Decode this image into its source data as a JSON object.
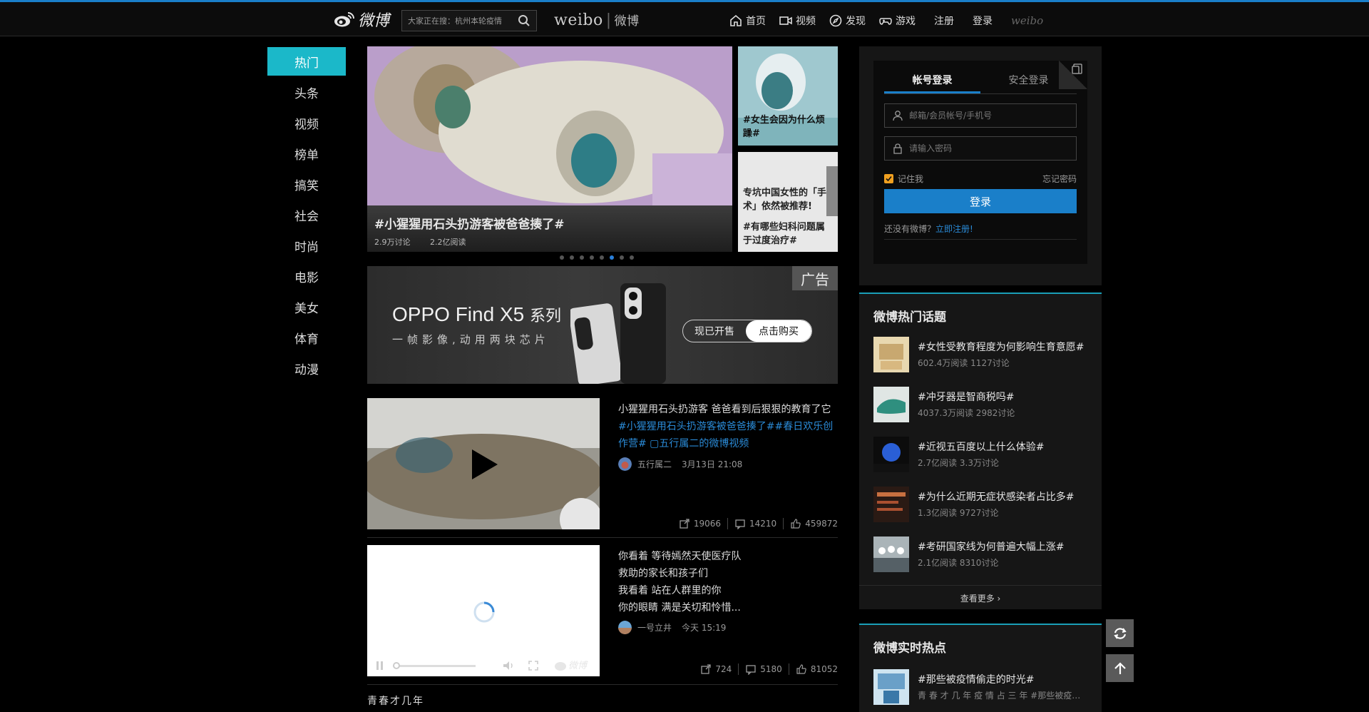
{
  "header": {
    "logo_text": "微博",
    "search_placeholder": "大家正在搜：杭州本轮疫情",
    "brand_en": "weibo",
    "brand_cn": "微博",
    "nav": [
      {
        "label": "首页",
        "icon": "home-icon"
      },
      {
        "label": "视频",
        "icon": "video-icon"
      },
      {
        "label": "发现",
        "icon": "discover-icon"
      },
      {
        "label": "游戏",
        "icon": "game-icon"
      }
    ],
    "register": "注册",
    "login": "登录",
    "mini_logo": "weibo"
  },
  "left_menu": [
    "热门",
    "头条",
    "视频",
    "榜单",
    "搞笑",
    "社会",
    "时尚",
    "电影",
    "美女",
    "体育",
    "动漫"
  ],
  "hero": {
    "title": "#小猩猩用石头扔游客被爸爸揍了#",
    "discuss": "2.9万讨论",
    "reads": "2.2亿阅读",
    "side1": "#女生会因为什么烦躁#",
    "side2_quote": "专坑中国女性的「手术」依然被推荐!",
    "side2_title": "#有哪些妇科问题属于过度治疗#",
    "dots_total": 8,
    "dots_active": 5
  },
  "ad": {
    "title": "OPPO Find X5",
    "title_suffix": "系列",
    "subtitle": "一帧影像,动用两块芯片",
    "tag": "广告",
    "btn1": "现已开售",
    "btn2": "点击购买"
  },
  "feed": [
    {
      "text": "小猩猩用石头扔游客 爸爸看到后狠狠的教育了它",
      "tags": "#小猩猩用石头扔游客被爸爸揍了##春日欢乐创作营# ▢五行属二的微博视频",
      "author": "五行属二",
      "time": "3月13日 21:08",
      "share": "19066",
      "comment": "14210",
      "like": "459872"
    },
    {
      "lines": [
        "你看着 等待嫣然天使医疗队",
        "救助的家长和孩子们",
        "我看着 站在人群里的你",
        "你的眼睛 满是关切和怜惜..."
      ],
      "author": "一号立井",
      "time": "今天 15:19",
      "share": "724",
      "comment": "5180",
      "like": "81052"
    }
  ],
  "bottom_text": "青春才几年",
  "login": {
    "tab1": "帐号登录",
    "tab2": "安全登录",
    "user_placeholder": "邮箱/会员帐号/手机号",
    "pass_placeholder": "请输入密码",
    "remember": "记住我",
    "forgot": "忘记密码",
    "button": "登录",
    "no_account": "还没有微博？",
    "register_now": "立即注册!"
  },
  "hot_topics": {
    "title": "微博热门话题",
    "items": [
      {
        "name": "#女性受教育程度为何影响生育意愿#",
        "meta": "602.4万阅读 1127讨论"
      },
      {
        "name": "#冲牙器是智商税吗#",
        "meta": "4037.3万阅读 2982讨论"
      },
      {
        "name": "#近视五百度以上什么体验#",
        "meta": "2.7亿阅读 3.3万讨论"
      },
      {
        "name": "#为什么近期无症状感染者占比多#",
        "meta": "1.3亿阅读 9727讨论"
      },
      {
        "name": "#考研国家线为何普遍大幅上涨#",
        "meta": "2.1亿阅读 8310讨论"
      }
    ],
    "more": "查看更多 ›"
  },
  "realtime": {
    "title": "微博实时热点",
    "items": [
      {
        "name": "#那些被疫情偷走的时光#",
        "meta": "青 春 才 几 年 疫 情 占 三 年 #那些被疫情偷走的时光#"
      }
    ]
  },
  "colors": {
    "accent": "#1a7fc9",
    "menu_active": "#1bb8c9",
    "link": "#2a8ad6"
  }
}
